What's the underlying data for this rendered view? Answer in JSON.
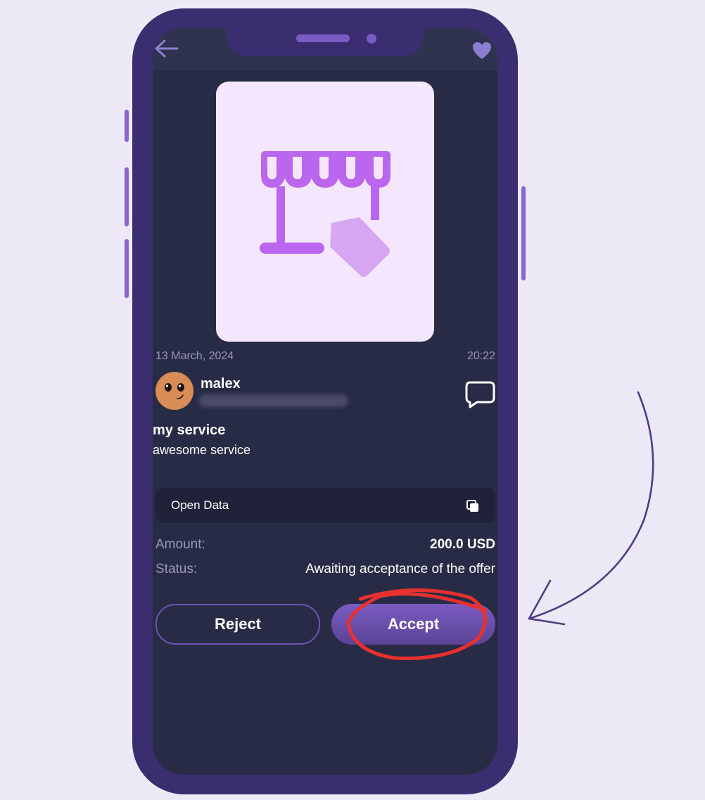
{
  "header": {
    "back_icon": "arrow-left-icon",
    "favorite_icon": "heart-icon"
  },
  "listing": {
    "image_icon": "storefront-tag-icon",
    "date": "13 March, 2024",
    "time": "20:22"
  },
  "seller": {
    "username": "malex",
    "avatar_icon": "smiley-avatar",
    "chat_icon": "chat-bubble-icon"
  },
  "service": {
    "title": "my service",
    "description": "awesome service"
  },
  "open_data": {
    "label": "Open Data",
    "icon": "copy-icon"
  },
  "details": {
    "amount_label": "Amount:",
    "amount_value": "200.0 USD",
    "status_label": "Status:",
    "status_value": "Awaiting acceptance of the offer"
  },
  "actions": {
    "reject_label": "Reject",
    "accept_label": "Accept"
  },
  "colors": {
    "frame": "#3a2e70",
    "screen": "#282b45",
    "accent": "#7b5bc2",
    "annotation_circle": "#e8302e",
    "annotation_arrow": "#4c3e82"
  }
}
